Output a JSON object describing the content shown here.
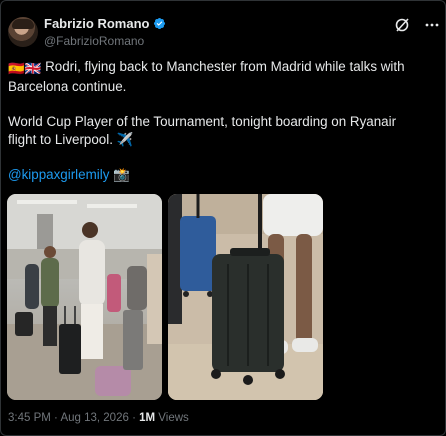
{
  "author": {
    "display_name": "Fabrizio Romano",
    "handle": "@FabrizioRomano",
    "verified": true
  },
  "header_icons": [
    "grok-icon",
    "more-icon"
  ],
  "tweet": {
    "line1": "Rodri, flying back to Manchester from Madrid while talks with Barcelona continue.",
    "flags": "🇪🇸🇬🇧",
    "line2": "World Cup Player of the Tournament, tonight boarding on Ryanair flight to Liverpool.",
    "line2_emoji": "✈️",
    "mention": "@kippaxgirlemily",
    "mention_emoji": "📸"
  },
  "media": {
    "photo_count": 2,
    "photos": [
      "airport-terminal-photo",
      "luggage-close-up-photo"
    ]
  },
  "meta": {
    "time": "3:45 PM",
    "separator": "·",
    "date": "Aug 13, 2026",
    "views_count": "1M",
    "views_label": "Views"
  },
  "colors": {
    "background": "#000000",
    "text": "#e7e9ea",
    "muted": "#71767b",
    "link": "#1d9bf0",
    "verified": "#1d9bf0"
  }
}
